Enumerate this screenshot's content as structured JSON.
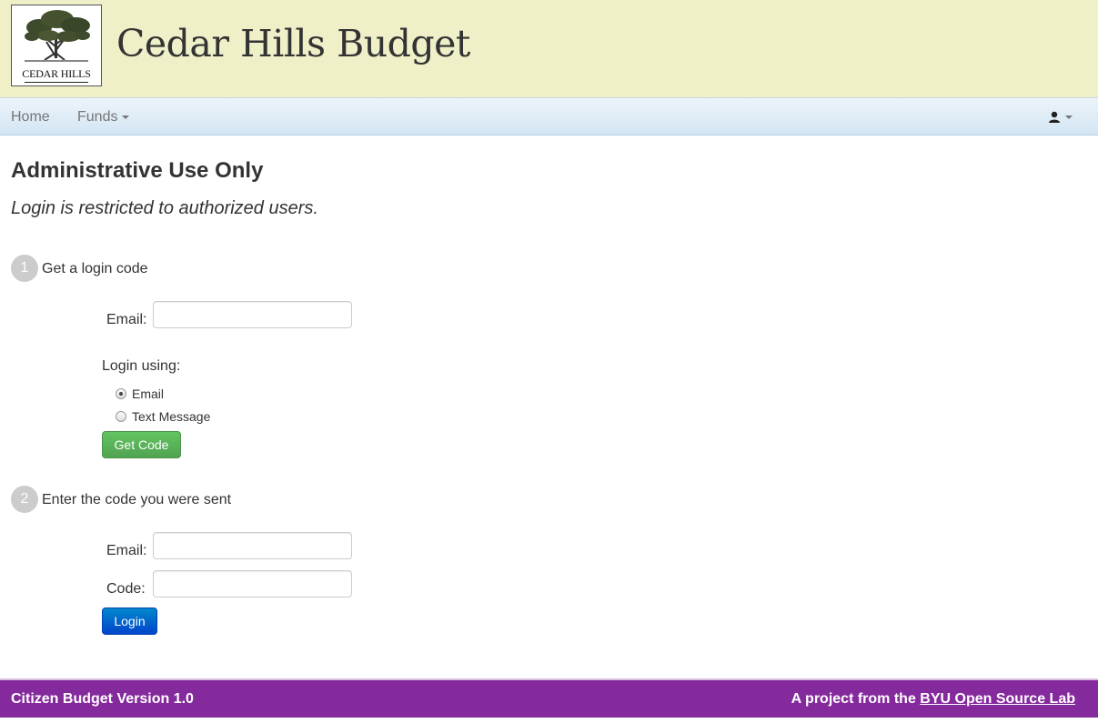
{
  "header": {
    "logo_text": "CEDAR HILLS",
    "title": "Cedar Hills Budget"
  },
  "navbar": {
    "home_label": "Home",
    "funds_label": "Funds",
    "user_icon": "user-icon"
  },
  "main": {
    "heading": "Administrative Use Only",
    "subheading": "Login is restricted to authorized users.",
    "step1": {
      "number": "1",
      "label": "Get a login code",
      "email_label": "Email:",
      "email_value": "",
      "login_using_label": "Login using:",
      "options": [
        {
          "label": "Email",
          "selected": true
        },
        {
          "label": "Text Message",
          "selected": false
        }
      ],
      "button_label": "Get Code"
    },
    "step2": {
      "number": "2",
      "label": "Enter the code you were sent",
      "email_label": "Email:",
      "email_value": "",
      "code_label": "Code:",
      "code_value": "",
      "button_label": "Login"
    }
  },
  "footer": {
    "version": "Citizen Budget Version 1.0",
    "project_prefix": "A project from the",
    "project_link": "BYU Open Source Lab"
  },
  "colors": {
    "header_bg": "#efefc8",
    "footer_bg": "#852a9d",
    "success": "#5bb75b",
    "primary": "#0066cc"
  }
}
